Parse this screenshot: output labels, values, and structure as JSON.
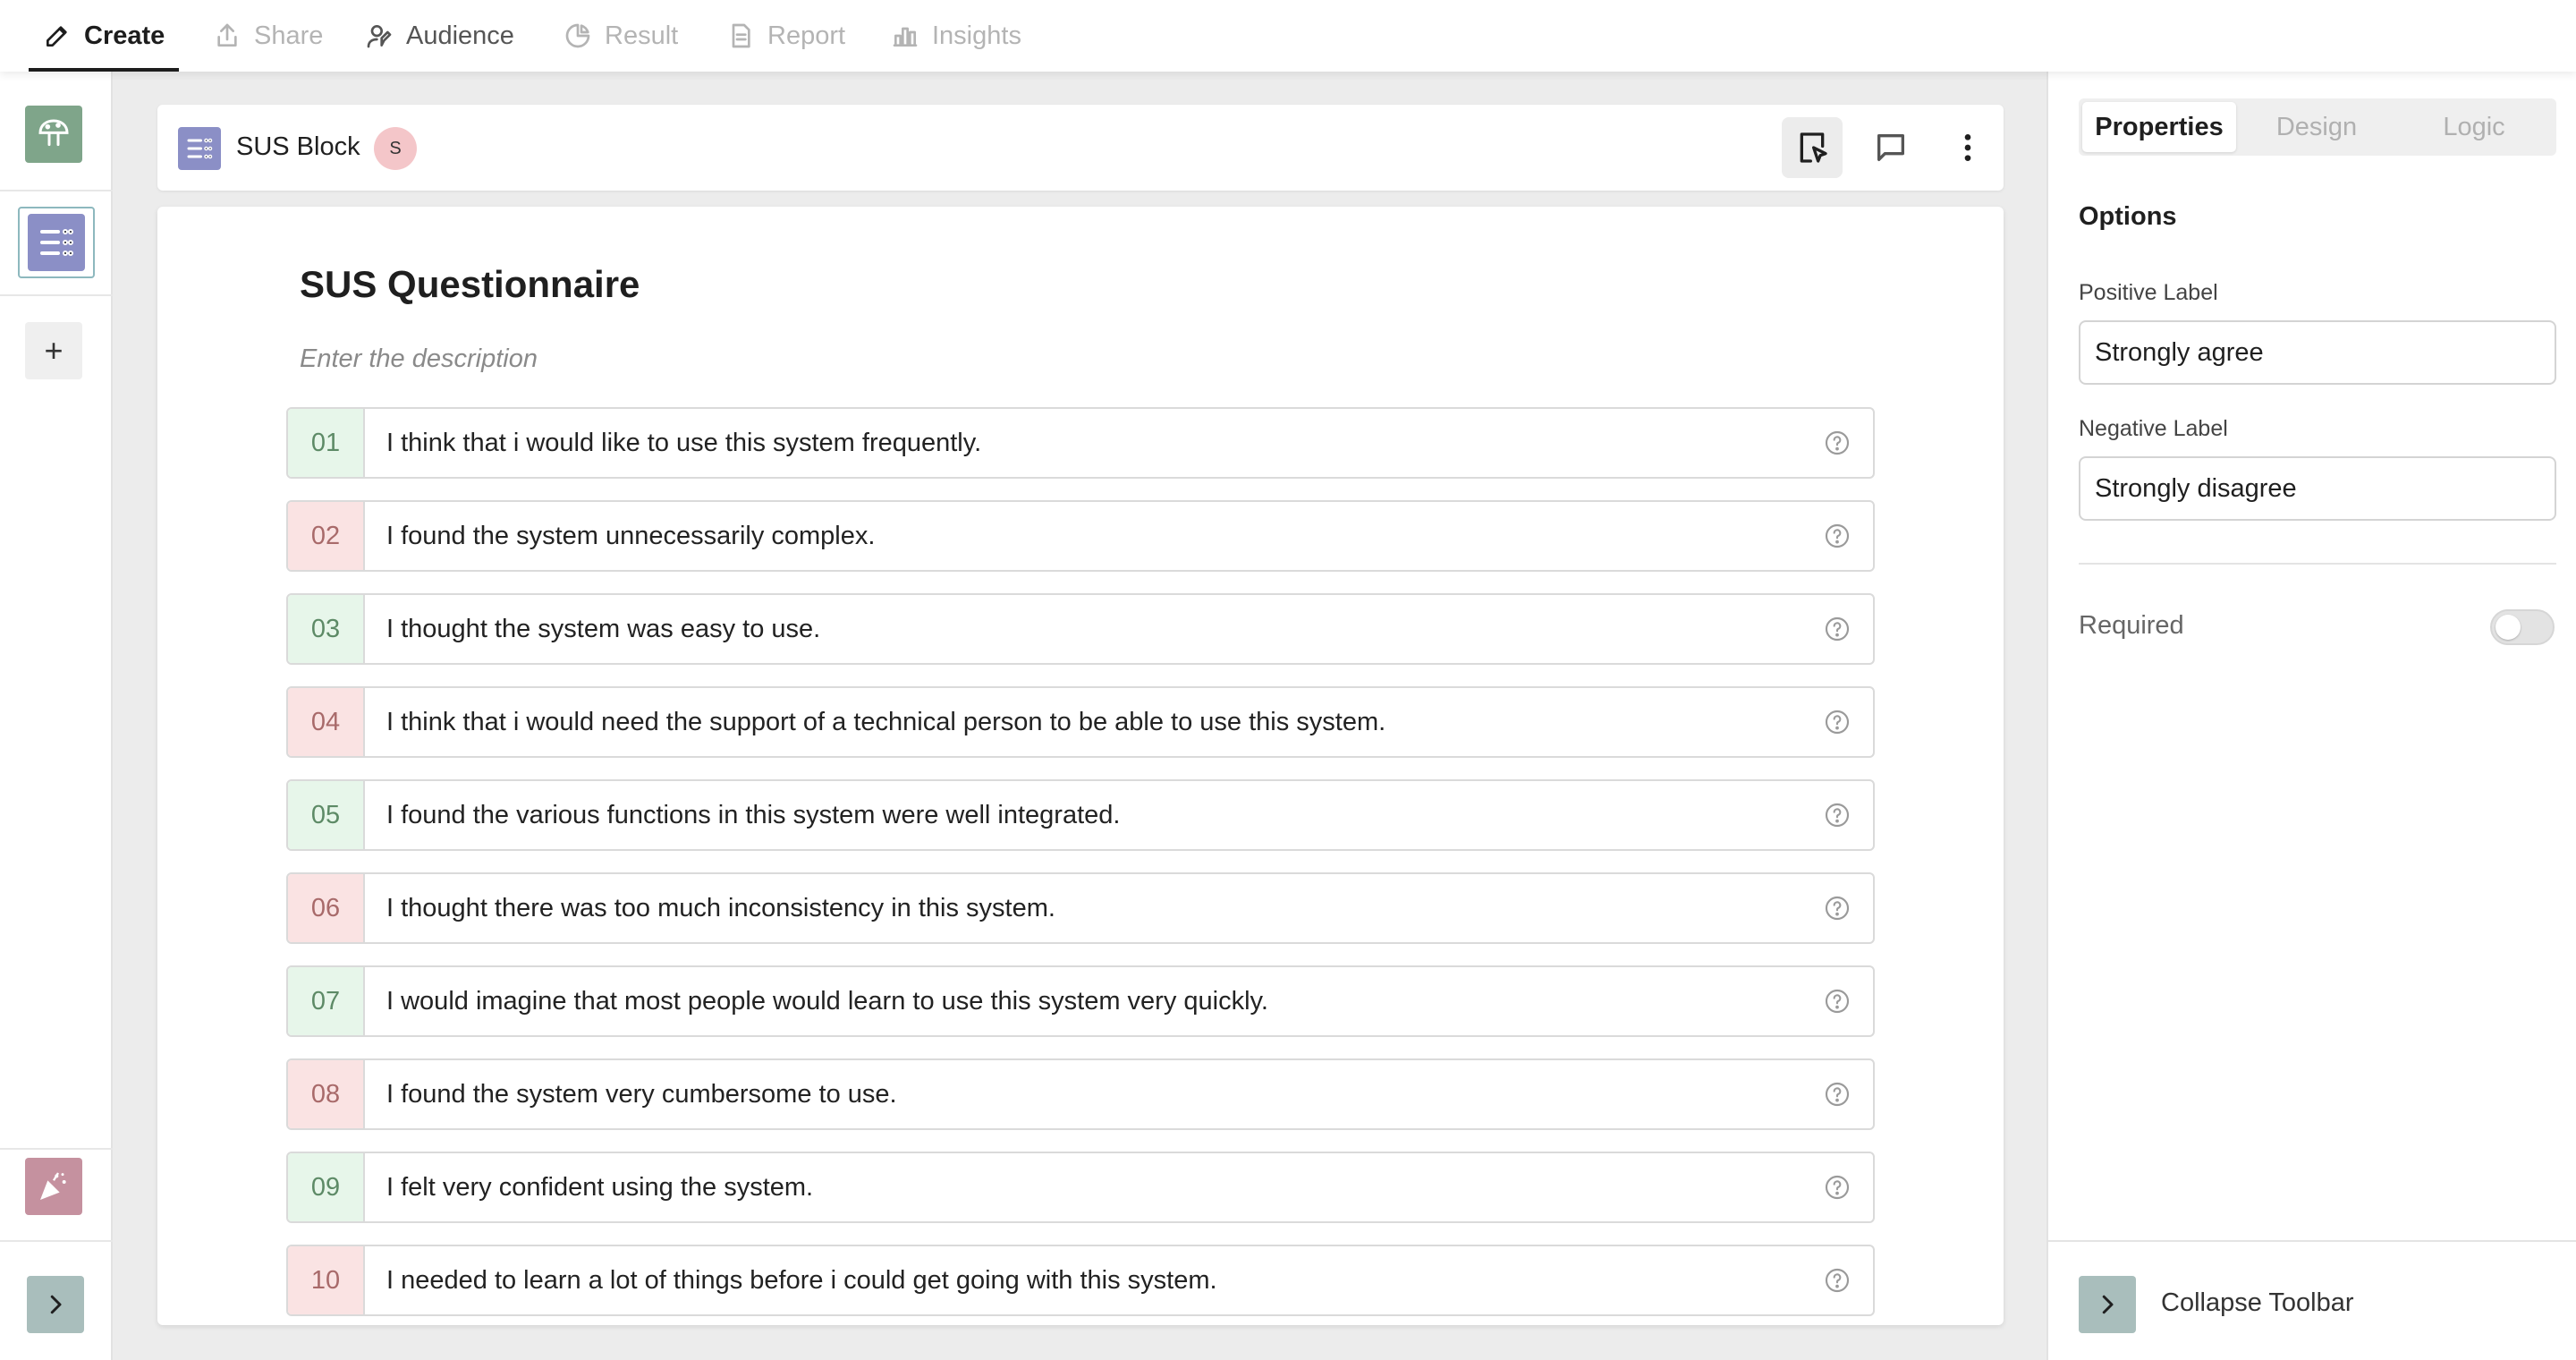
{
  "nav": {
    "tabs": [
      {
        "label": "Create",
        "icon": "pencil-icon"
      },
      {
        "label": "Share",
        "icon": "share-icon"
      },
      {
        "label": "Audience",
        "icon": "audience-icon"
      },
      {
        "label": "Result",
        "icon": "pie-chart-icon"
      },
      {
        "label": "Report",
        "icon": "document-icon"
      },
      {
        "label": "Insights",
        "icon": "bar-chart-icon"
      }
    ],
    "active": "Create"
  },
  "rail": {
    "add_label": "+"
  },
  "block": {
    "name": "SUS Block",
    "avatar_initial": "S"
  },
  "questionnaire": {
    "title": "SUS Questionnaire",
    "description_placeholder": "Enter the description",
    "questions": [
      {
        "num": "01",
        "text": "I think that i would like to use this system frequently.",
        "polarity": "positive"
      },
      {
        "num": "02",
        "text": "I found the system unnecessarily complex.",
        "polarity": "negative"
      },
      {
        "num": "03",
        "text": "I thought the system was easy to use.",
        "polarity": "positive"
      },
      {
        "num": "04",
        "text": "I think that i would need the support of a technical person to be able to use this system.",
        "polarity": "negative"
      },
      {
        "num": "05",
        "text": "I found the various functions in this system were well integrated.",
        "polarity": "positive"
      },
      {
        "num": "06",
        "text": "I thought there was too much inconsistency in this system.",
        "polarity": "negative"
      },
      {
        "num": "07",
        "text": "I would imagine that most people would learn to use this system very quickly.",
        "polarity": "positive"
      },
      {
        "num": "08",
        "text": "I found the system very cumbersome to use.",
        "polarity": "negative"
      },
      {
        "num": "09",
        "text": "I felt very confident using the system.",
        "polarity": "positive"
      },
      {
        "num": "10",
        "text": "I needed to learn a lot of things before i could get going with this system.",
        "polarity": "negative"
      }
    ]
  },
  "panel": {
    "tabs": [
      "Properties",
      "Design",
      "Logic"
    ],
    "active_tab": "Properties",
    "options_heading": "Options",
    "positive_label_title": "Positive Label",
    "positive_label_value": "Strongly agree",
    "negative_label_title": "Negative Label",
    "negative_label_value": "Strongly disagree",
    "required_label": "Required",
    "required_on": false,
    "collapse_label": "Collapse Toolbar"
  },
  "colors": {
    "positive_bg": "#e7f6ea",
    "negative_bg": "#fae3e3",
    "block_icon": "#8b8fc6",
    "thumb_green": "#7fa58a",
    "thumb_pink": "#c5919f",
    "collapse_btn": "#a9bebc"
  }
}
